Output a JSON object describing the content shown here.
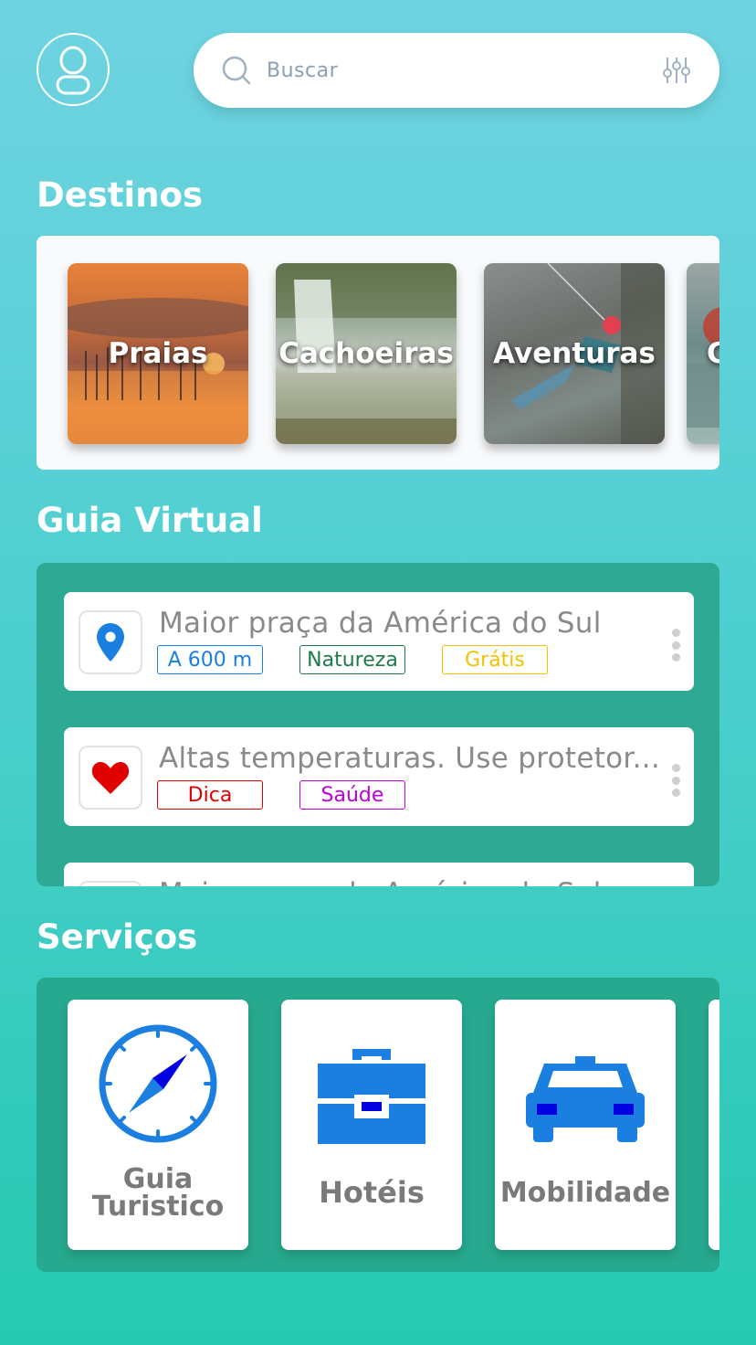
{
  "search": {
    "placeholder": "Buscar"
  },
  "sections": {
    "destinos": "Destinos",
    "guia": "Guia Virtual",
    "servicos": "Serviços"
  },
  "destinos": [
    {
      "label": "Praias"
    },
    {
      "label": "Cachoeiras"
    },
    {
      "label": "Aventuras"
    },
    {
      "label": "C"
    }
  ],
  "guia": {
    "items": [
      {
        "title": "Maior praça da América do Sul",
        "icon": "map-pin-icon",
        "tags": [
          {
            "label": "A 600 m",
            "color": "#1a7fe0"
          },
          {
            "label": "Natureza",
            "color": "#1f7a4a"
          },
          {
            "label": "Grátis",
            "color": "#f2c200"
          }
        ]
      },
      {
        "title": "Altas temperaturas. Use protetor...",
        "icon": "heart-icon",
        "tags": [
          {
            "label": "Dica",
            "color": "#e00000"
          },
          {
            "label": "Saúde",
            "color": "#c000e0"
          }
        ]
      },
      {
        "title": "Maior praça da América do Sul",
        "icon": "map-pin-icon"
      }
    ]
  },
  "servicos": [
    {
      "label_line1": "Guia",
      "label_line2": "Turistico",
      "icon": "compass-icon"
    },
    {
      "label": "Hotéis",
      "icon": "briefcase-icon"
    },
    {
      "label": "Mobilidade",
      "icon": "taxi-icon"
    }
  ],
  "colors": {
    "accent_blue": "#1a7fe0",
    "heart_red": "#e00000",
    "panel_teal": "#2ea994"
  }
}
